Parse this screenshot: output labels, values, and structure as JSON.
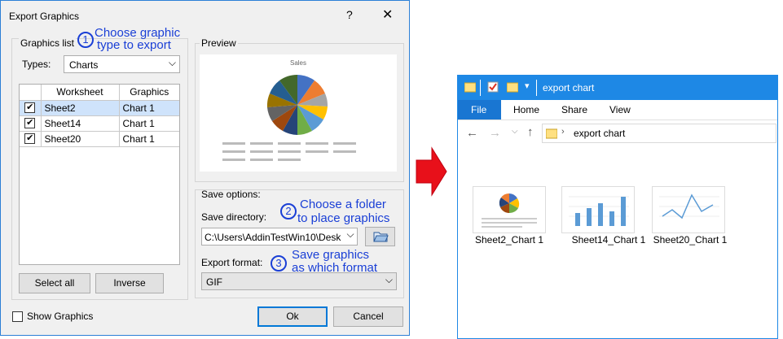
{
  "dialog": {
    "title": "Export Graphics",
    "help": "?",
    "close": "✕",
    "graphics_list_label": "Graphics list",
    "types_label": "Types:",
    "types_value": "Charts",
    "table_headers": [
      "Worksheet",
      "Graphics"
    ],
    "rows": [
      {
        "checked": true,
        "worksheet": "Sheet2",
        "graphic": "Chart 1"
      },
      {
        "checked": true,
        "worksheet": "Sheet14",
        "graphic": "Chart 1"
      },
      {
        "checked": true,
        "worksheet": "Sheet20",
        "graphic": "Chart 1"
      }
    ],
    "select_all": "Select all",
    "inverse": "Inverse",
    "show_graphics": "Show Graphics",
    "preview_label": "Preview",
    "preview_chart_title": "Sales",
    "save_options_label": "Save options:",
    "save_directory_label": "Save directory:",
    "save_directory_value": "C:\\Users\\AddinTestWin10\\Desk",
    "export_format_label": "Export format:",
    "export_format_value": "GIF",
    "ok": "Ok",
    "cancel": "Cancel"
  },
  "callouts": [
    {
      "num": "1",
      "line1": "Choose graphic",
      "line2": "type to export"
    },
    {
      "num": "2",
      "line1": "Choose a folder",
      "line2": "to place graphics"
    },
    {
      "num": "3",
      "line1": "Save graphics",
      "line2": "as which format"
    }
  ],
  "explorer": {
    "title": "export chart",
    "tabs": [
      "File",
      "Home",
      "Share",
      "View"
    ],
    "address": "export chart",
    "files": [
      "Sheet2_Chart 1",
      "Sheet14_Chart 1",
      "Sheet20_Chart 1"
    ],
    "accent": "#1e88e5"
  },
  "colors": {
    "arrow": "#e8101a",
    "callout": "#1a3fd6",
    "dialog_border": "#2b7fd6"
  }
}
